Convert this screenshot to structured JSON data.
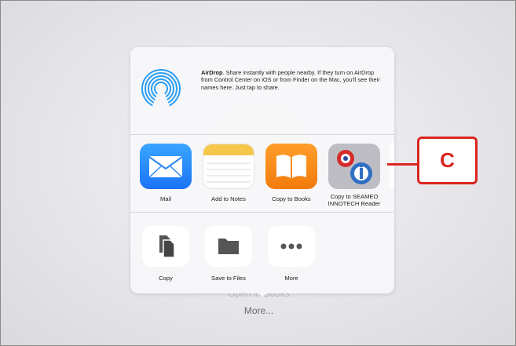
{
  "background": {
    "open_in_text": "Open in Books",
    "more_text": "More..."
  },
  "airdrop": {
    "title": "AirDrop",
    "description": ". Share instantly with people nearby. If they turn on AirDrop from Control Center on iOS or from Finder on the Mac, you'll see their names here. Just tap to share."
  },
  "apps": [
    {
      "label": "Mail",
      "icon": "mail-icon"
    },
    {
      "label": "Add to Notes",
      "icon": "notes-icon"
    },
    {
      "label": "Copy to Books",
      "icon": "books-icon"
    },
    {
      "label": "Copy to SEAMEO INNOTECH Reader",
      "icon": "seameo-innotech-icon"
    }
  ],
  "actions": [
    {
      "label": "Copy",
      "icon": "copy-icon"
    },
    {
      "label": "Save to Files",
      "icon": "folder-icon"
    },
    {
      "label": "More",
      "icon": "more-dots-icon"
    }
  ],
  "callout": {
    "label": "C",
    "color": "#d9251f"
  }
}
